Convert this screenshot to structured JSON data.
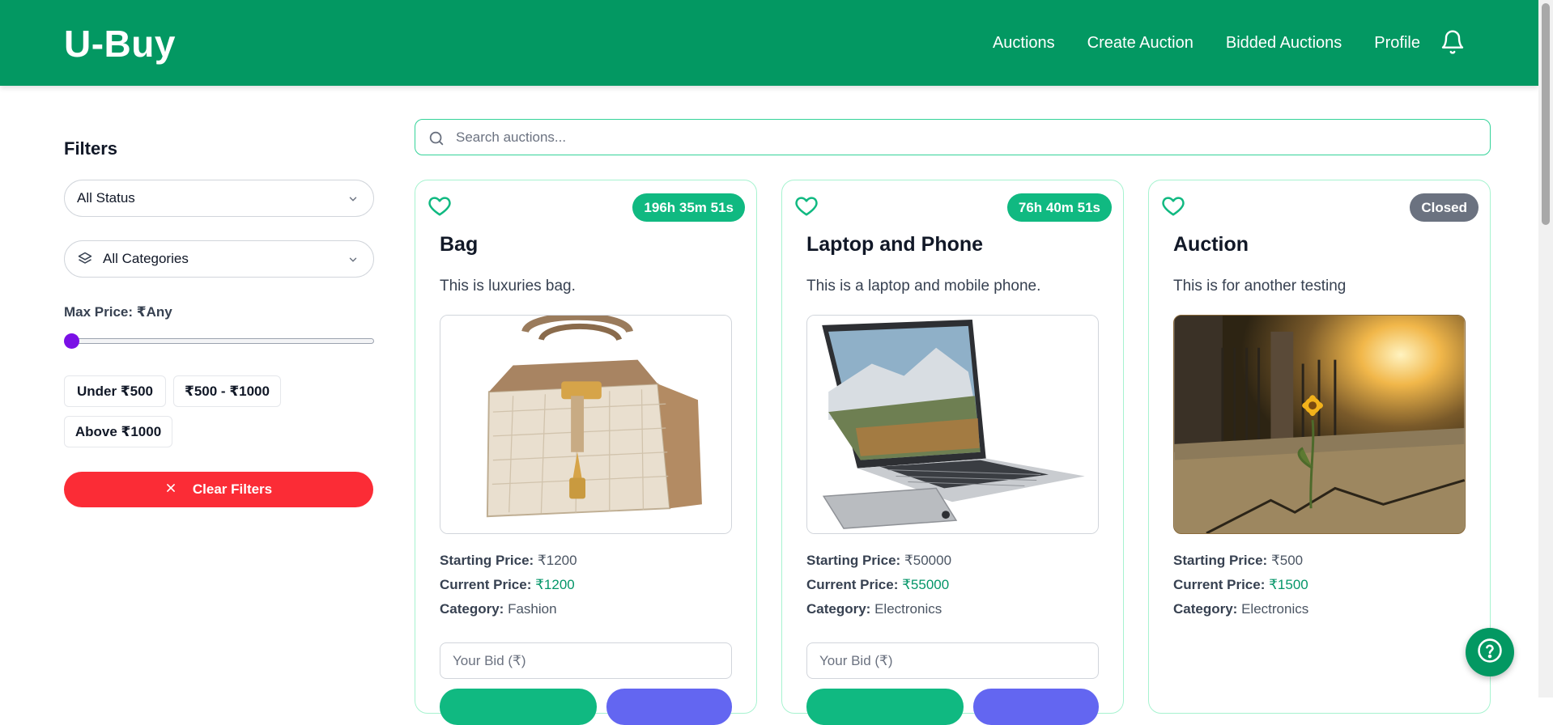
{
  "header": {
    "brand": "U-Buy",
    "nav": [
      "Auctions",
      "Create Auction",
      "Bidded Auctions",
      "Profile"
    ],
    "bell_icon": "bell-icon"
  },
  "sidebar": {
    "title": "Filters",
    "status_select": "All Status",
    "category_select": "All Categories",
    "max_price_label": "Max Price: ₹Any",
    "max_price_fraction": 0,
    "price_chips": [
      "Under ₹500",
      "₹500 - ₹1000",
      "Above ₹1000"
    ],
    "clear_label": "Clear Filters"
  },
  "search": {
    "placeholder": "Search auctions..."
  },
  "cards": [
    {
      "timer": "196h 35m 51s",
      "status": "live",
      "title": "Bag",
      "description": "This is luxuries bag.",
      "starting_label": "Starting Price:",
      "starting_price": "₹1200",
      "current_label": "Current Price:",
      "current_price": "₹1200",
      "category_label": "Category:",
      "category": "Fashion",
      "bid_placeholder": "Your Bid (₹)",
      "image": "handbag-image"
    },
    {
      "timer": "76h 40m 51s",
      "status": "live",
      "title": "Laptop and Phone",
      "description": "This is a laptop and mobile phone.",
      "starting_label": "Starting Price:",
      "starting_price": "₹50000",
      "current_label": "Current Price:",
      "current_price": "₹55000",
      "category_label": "Category:",
      "category": "Electronics",
      "bid_placeholder": "Your Bid (₹)",
      "image": "laptop-phone-image"
    },
    {
      "timer": "Closed",
      "status": "closed",
      "title": "Auction",
      "description": "This is for another testing",
      "starting_label": "Starting Price:",
      "starting_price": "₹500",
      "current_label": "Current Price:",
      "current_price": "₹1500",
      "category_label": "Category:",
      "category": "Electronics",
      "image": "flower-sunset-image"
    }
  ],
  "colors": {
    "brand_green": "#039862",
    "accent_green": "#10b981",
    "danger_red": "#fb2c36",
    "slider_purple": "#7a10e6",
    "action_indigo": "#6366f1",
    "closed_gray": "#6b7280"
  },
  "help_icon": "question-circle-icon"
}
